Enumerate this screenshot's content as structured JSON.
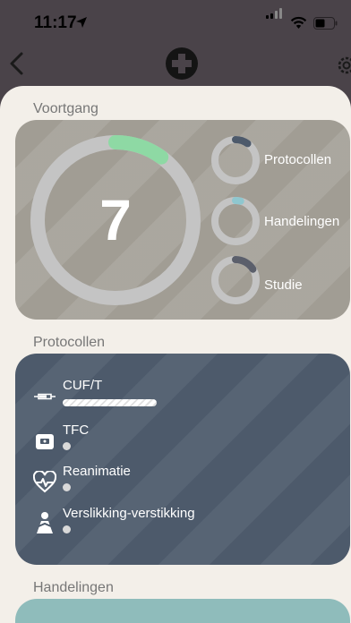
{
  "status_bar": {
    "time": "11:17"
  },
  "progress": {
    "section_title": "Voortgang",
    "total": "7",
    "total_fraction": 0.1,
    "rings": [
      {
        "label": "Protocollen",
        "fraction": 0.1,
        "color": "#4d5a6b"
      },
      {
        "label": "Handelingen",
        "fraction": 0.04,
        "color": "#8fc7cf"
      },
      {
        "label": "Studie",
        "fraction": 0.16,
        "color": "#5b5f6b"
      }
    ],
    "main_color": "#8ed9a4"
  },
  "protocols": {
    "section_title": "Protocollen",
    "items": [
      {
        "name": "CUF/T",
        "icon": "syringe-icon",
        "progress": 1.0
      },
      {
        "name": "TFC",
        "icon": "device-icon",
        "progress": 0
      },
      {
        "name": "Reanimatie",
        "icon": "heartbeat-icon",
        "progress": 0
      },
      {
        "name": "Verslikking-verstikking",
        "icon": "choking-icon",
        "progress": 0
      }
    ]
  },
  "handelingen": {
    "section_title": "Handelingen"
  }
}
